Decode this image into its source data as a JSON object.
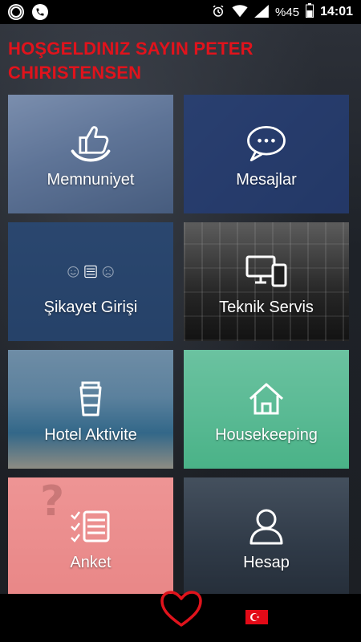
{
  "status_bar": {
    "battery": "%45",
    "time": "14:01",
    "icons": [
      "record-icon",
      "phone-icon",
      "alarm-icon",
      "wifi-icon",
      "signal-icon",
      "battery-icon"
    ]
  },
  "greeting": "HOŞGELDINIZ SAYIN PETER CHIRISTENSEN",
  "tiles": [
    {
      "label": "Memnuniyet",
      "icon": "thumbs-up-smile-icon"
    },
    {
      "label": "Mesajlar",
      "icon": "chat-bubble-icon"
    },
    {
      "label": "Şikayet Girişi",
      "icon": "complaint-form-icon"
    },
    {
      "label": "Teknik Servis",
      "icon": "devices-icon"
    },
    {
      "label": "Hotel Aktivite",
      "icon": "coffee-cup-icon"
    },
    {
      "label": "Housekeeping",
      "icon": "home-icon"
    },
    {
      "label": "Anket",
      "icon": "checklist-icon"
    },
    {
      "label": "Hesap",
      "icon": "user-icon"
    }
  ],
  "bottom_bar": {
    "heart": "heart-icon",
    "flag": "turkey-flag-icon"
  },
  "colors": {
    "accent": "#e0131c",
    "heart": "#e0131c"
  }
}
